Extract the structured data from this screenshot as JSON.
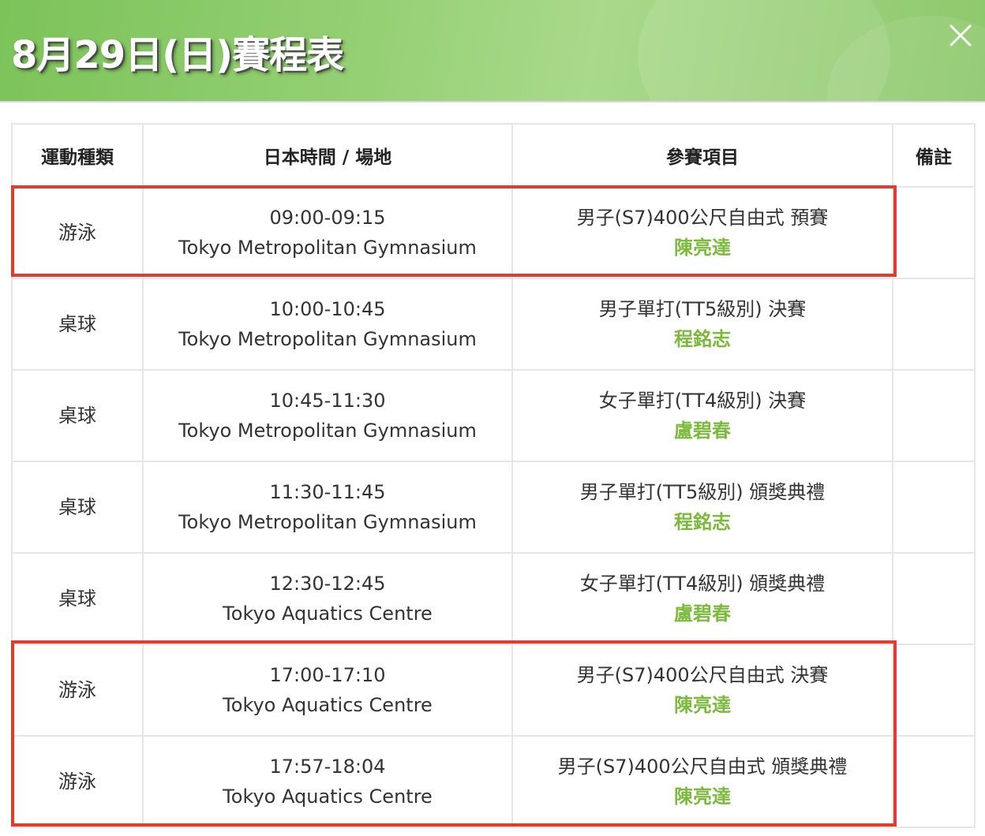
{
  "header": {
    "title": "8月29日(日)賽程表",
    "close_icon": "close-icon"
  },
  "table": {
    "columns": [
      "運動種類",
      "日本時間 / 場地",
      "參賽項目",
      "備註"
    ],
    "rows": [
      {
        "sport": "游泳",
        "time": "09:00-09:15",
        "venue": "Tokyo Metropolitan Gymnasium",
        "event": "男子(S7)400公尺自由式 預賽",
        "athlete": "陳亮達",
        "note": ""
      },
      {
        "sport": "桌球",
        "time": "10:00-10:45",
        "venue": "Tokyo Metropolitan Gymnasium",
        "event": "男子單打(TT5級別) 決賽",
        "athlete": "程銘志",
        "note": ""
      },
      {
        "sport": "桌球",
        "time": "10:45-11:30",
        "venue": "Tokyo Metropolitan Gymnasium",
        "event": "女子單打(TT4級別) 決賽",
        "athlete": "盧碧春",
        "note": ""
      },
      {
        "sport": "桌球",
        "time": "11:30-11:45",
        "venue": "Tokyo Metropolitan Gymnasium",
        "event": "男子單打(TT5級別) 頒獎典禮",
        "athlete": "程銘志",
        "note": ""
      },
      {
        "sport": "桌球",
        "time": "12:30-12:45",
        "venue": "Tokyo Aquatics Centre",
        "event": "女子單打(TT4級別) 頒獎典禮",
        "athlete": "盧碧春",
        "note": ""
      },
      {
        "sport": "游泳",
        "time": "17:00-17:10",
        "venue": "Tokyo Aquatics Centre",
        "event": "男子(S7)400公尺自由式 決賽",
        "athlete": "陳亮達",
        "note": ""
      },
      {
        "sport": "游泳",
        "time": "17:57-18:04",
        "venue": "Tokyo Aquatics Centre",
        "event": "男子(S7)400公尺自由式 頒獎典禮",
        "athlete": "陳亮達",
        "note": ""
      }
    ]
  },
  "colors": {
    "header_green": "#8ec86c",
    "athlete_green": "#7cba3e",
    "highlight_red": "#e33b2e",
    "grid": "#e6e6e6"
  }
}
